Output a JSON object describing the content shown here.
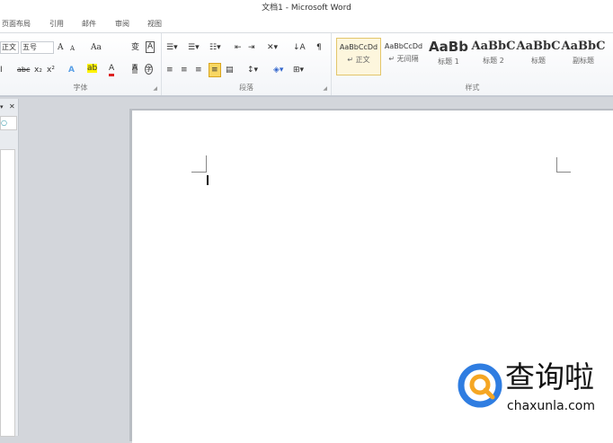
{
  "window": {
    "title": "文档1 - Microsoft Word"
  },
  "tabs": [
    "页面布局",
    "引用",
    "邮件",
    "审阅",
    "视图"
  ],
  "font_group": {
    "label": "字体",
    "font_name": "正文",
    "font_size": "五号",
    "grow": "A",
    "shrink": "A",
    "case": "Aa",
    "phonetic": "变",
    "border": "A",
    "bold": "I",
    "strike": "abc",
    "sub": "x₂",
    "sup": "x²",
    "effects": "A",
    "highlight": "ab",
    "color": "A",
    "shade": "A",
    "enclose": "字"
  },
  "paragraph_group": {
    "label": "段落"
  },
  "styles_group": {
    "label": "样式",
    "styles": [
      {
        "preview": "AaBbCcDd",
        "name": "↵ 正文"
      },
      {
        "preview": "AaBbCcDd",
        "name": "↵ 无间隔"
      },
      {
        "preview": "AaBb",
        "name": "标题 1"
      },
      {
        "preview": "AaBbC",
        "name": "标题 2"
      },
      {
        "preview": "AaBbC",
        "name": "标题"
      },
      {
        "preview": "AaBbC",
        "name": "副标题"
      }
    ]
  },
  "pane": {
    "close": "✕",
    "pin": "▾"
  },
  "watermark": {
    "brand": "查询啦",
    "domain": "chaxunla.com",
    "colors": {
      "blue": "#2f7de1",
      "orange": "#f5a623"
    }
  }
}
